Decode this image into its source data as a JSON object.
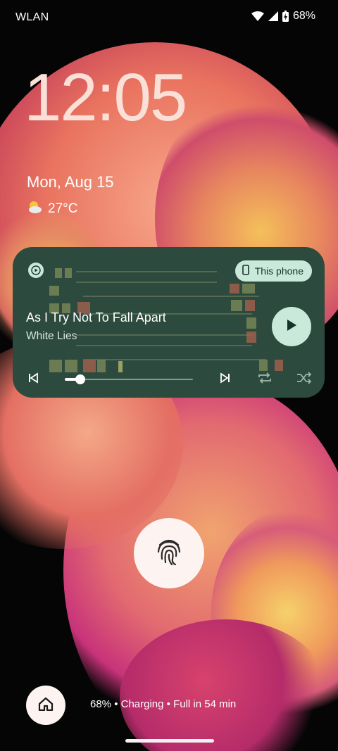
{
  "status_bar": {
    "network_label": "WLAN",
    "battery_percent": "68%",
    "icons": [
      "wifi-icon",
      "cell-signal-icon",
      "battery-charging-icon"
    ]
  },
  "lockscreen": {
    "time": "12:05",
    "date": "Mon, Aug 15",
    "weather": {
      "icon": "partly-sunny-icon",
      "temperature": "27°C"
    }
  },
  "media": {
    "app_icon": "play-circle-icon",
    "output_device": "This phone",
    "title": "As I Try Not To Fall Apart",
    "artist": "White Lies",
    "progress": 0.12,
    "controls": [
      "previous-icon",
      "play-icon",
      "next-icon",
      "repeat-icon",
      "shuffle-icon"
    ],
    "accent_color": "#c9eadb",
    "card_color": "#2d4a3f"
  },
  "fingerprint": {
    "icon": "fingerprint-icon"
  },
  "bottom": {
    "home_icon": "home-icon",
    "charging_text": "68% • Charging • Full in 54 min"
  }
}
